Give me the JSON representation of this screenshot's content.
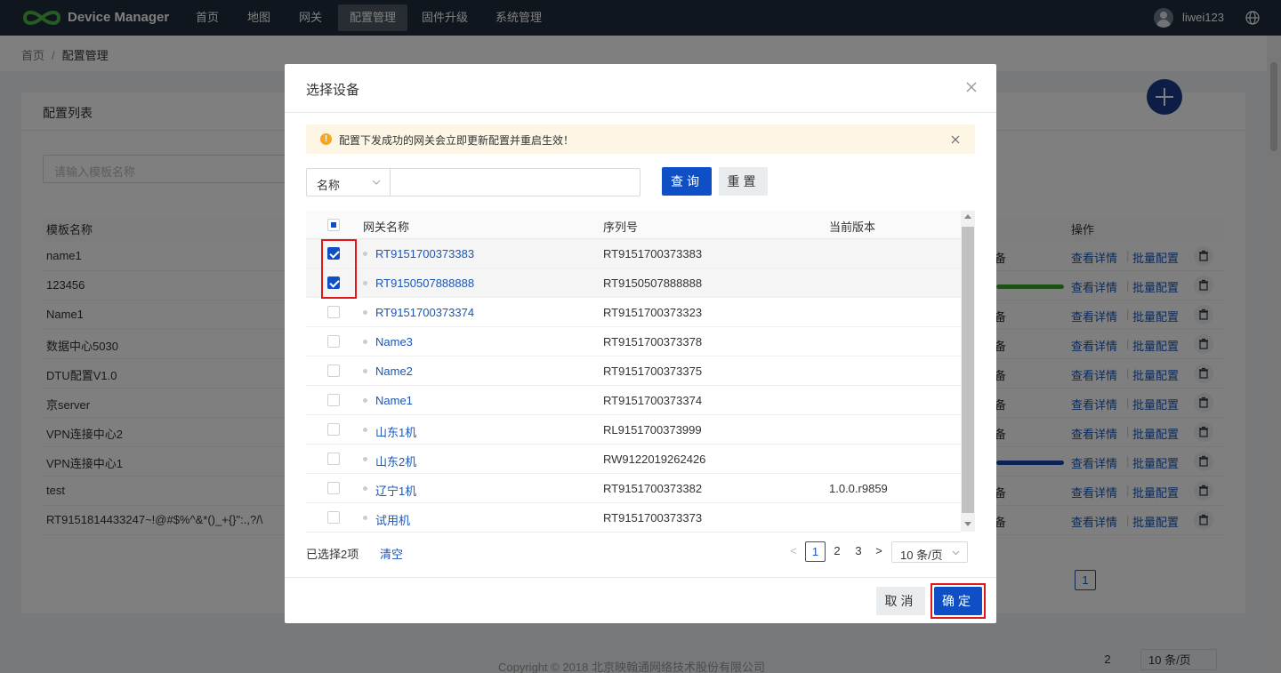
{
  "app": {
    "brand": "Device Manager",
    "nav": [
      "首页",
      "地图",
      "网关",
      "配置管理",
      "固件升级",
      "系统管理"
    ],
    "active_nav_index": 3,
    "user": "liwei123"
  },
  "breadcrumb": {
    "home": "首页",
    "separator": "/",
    "current": "配置管理"
  },
  "background": {
    "card_title": "配置列表",
    "search_placeholder": "请输入模板名称",
    "columns": {
      "name": "模板名称",
      "ops": "操作"
    },
    "rows": [
      {
        "name": "name1",
        "status": "备"
      },
      {
        "name": "123456",
        "status": "",
        "bar_color": "#3aa32a"
      },
      {
        "name": "Name1",
        "status": "备"
      },
      {
        "name": "数据中心5030",
        "status": "备"
      },
      {
        "name": "DTU配置V1.0",
        "status": "备"
      },
      {
        "name": "京server",
        "status": "备"
      },
      {
        "name": "VPN连接中心2",
        "status": "备"
      },
      {
        "name": "VPN连接中心1",
        "status": "",
        "bar_color": "#1a44a8"
      },
      {
        "name": "test",
        "status": "备"
      },
      {
        "name": "RT9151814433247~!@#$%^&*()_+{}\":.,?/\\",
        "status": "备"
      }
    ],
    "op_view": "查看详情",
    "op_batch": "批量配置",
    "pager": {
      "pages": [
        "1",
        "2"
      ],
      "current": "1",
      "size": "10 条/页"
    },
    "footer": "Copyright © 2018 北京映翰通网络技术股份有限公司"
  },
  "modal": {
    "title": "选择设备",
    "alert": "配置下发成功的网关会立即更新配置并重启生效！",
    "field_select": "名称",
    "query_button": "查询",
    "reset_button": "重置",
    "columns": {
      "name": "网关名称",
      "sn": "序列号",
      "version": "当前版本"
    },
    "rows": [
      {
        "name": "RT9151700373383",
        "sn": "RT9151700373383",
        "version": "",
        "checked": true
      },
      {
        "name": "RT9150507888888",
        "sn": "RT9150507888888",
        "version": "",
        "checked": true
      },
      {
        "name": "RT9151700373374",
        "sn": "RT9151700373323",
        "version": "",
        "checked": false
      },
      {
        "name": "Name3",
        "sn": "RT9151700373378",
        "version": "",
        "checked": false
      },
      {
        "name": "Name2",
        "sn": "RT9151700373375",
        "version": "",
        "checked": false
      },
      {
        "name": "Name1",
        "sn": "RT9151700373374",
        "version": "",
        "checked": false
      },
      {
        "name": "山东1机",
        "sn": "RL9151700373999",
        "version": "",
        "checked": false
      },
      {
        "name": "山东2机",
        "sn": "RW9122019262426",
        "version": "",
        "checked": false
      },
      {
        "name": "辽宁1机",
        "sn": "RT9151700373382",
        "version": "1.0.0.r9859",
        "checked": false
      },
      {
        "name": "试用机",
        "sn": "RT9151700373373",
        "version": "",
        "checked": false
      }
    ],
    "selected_count": "已选择2项",
    "clear_link": "清空",
    "pager": {
      "prev": "<",
      "pages": [
        "1",
        "2",
        "3"
      ],
      "current": "1",
      "next": ">",
      "size": "10 条/页"
    },
    "cancel_button": "取消",
    "confirm_button": "确定"
  },
  "colors": {
    "primary": "#0f4fc5",
    "nav_bg": "#1f2d3d",
    "link": "#1a56b8",
    "highlight": "#e0161b",
    "alert_bg": "#fdf6e4"
  },
  "icons": [
    "logo-icon",
    "user-avatar-icon",
    "globe-icon",
    "plus-icon",
    "trash-icon",
    "close-icon",
    "warning-icon",
    "chevron-down-icon",
    "checkbox-icon"
  ]
}
